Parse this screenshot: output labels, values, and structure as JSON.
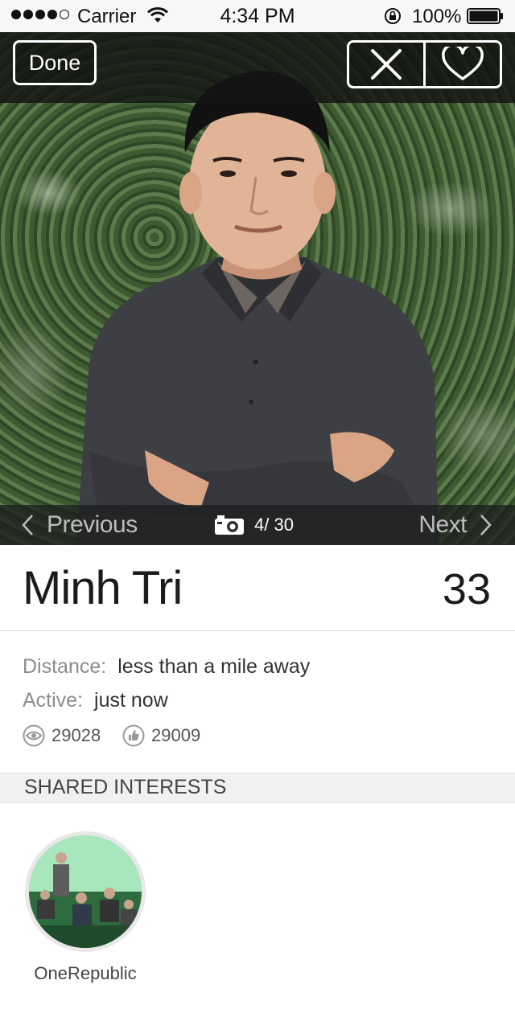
{
  "status_bar": {
    "carrier": "Carrier",
    "time": "4:34 PM",
    "battery": "100%"
  },
  "toolbar": {
    "done_label": "Done",
    "reject_icon": "close-icon",
    "like_icon": "heart-icon"
  },
  "photo_nav": {
    "previous_label": "Previous",
    "next_label": "Next",
    "count": "4/ 30"
  },
  "profile": {
    "name": "Minh Tri",
    "age": "33",
    "distance_label": "Distance:",
    "distance_value": "less than a mile away",
    "active_label": "Active:",
    "active_value": "just now",
    "views": "29028",
    "likes": "29009"
  },
  "shared_interests": {
    "header": "SHARED INTERESTS",
    "items": [
      {
        "label": "OneRepublic"
      }
    ]
  }
}
